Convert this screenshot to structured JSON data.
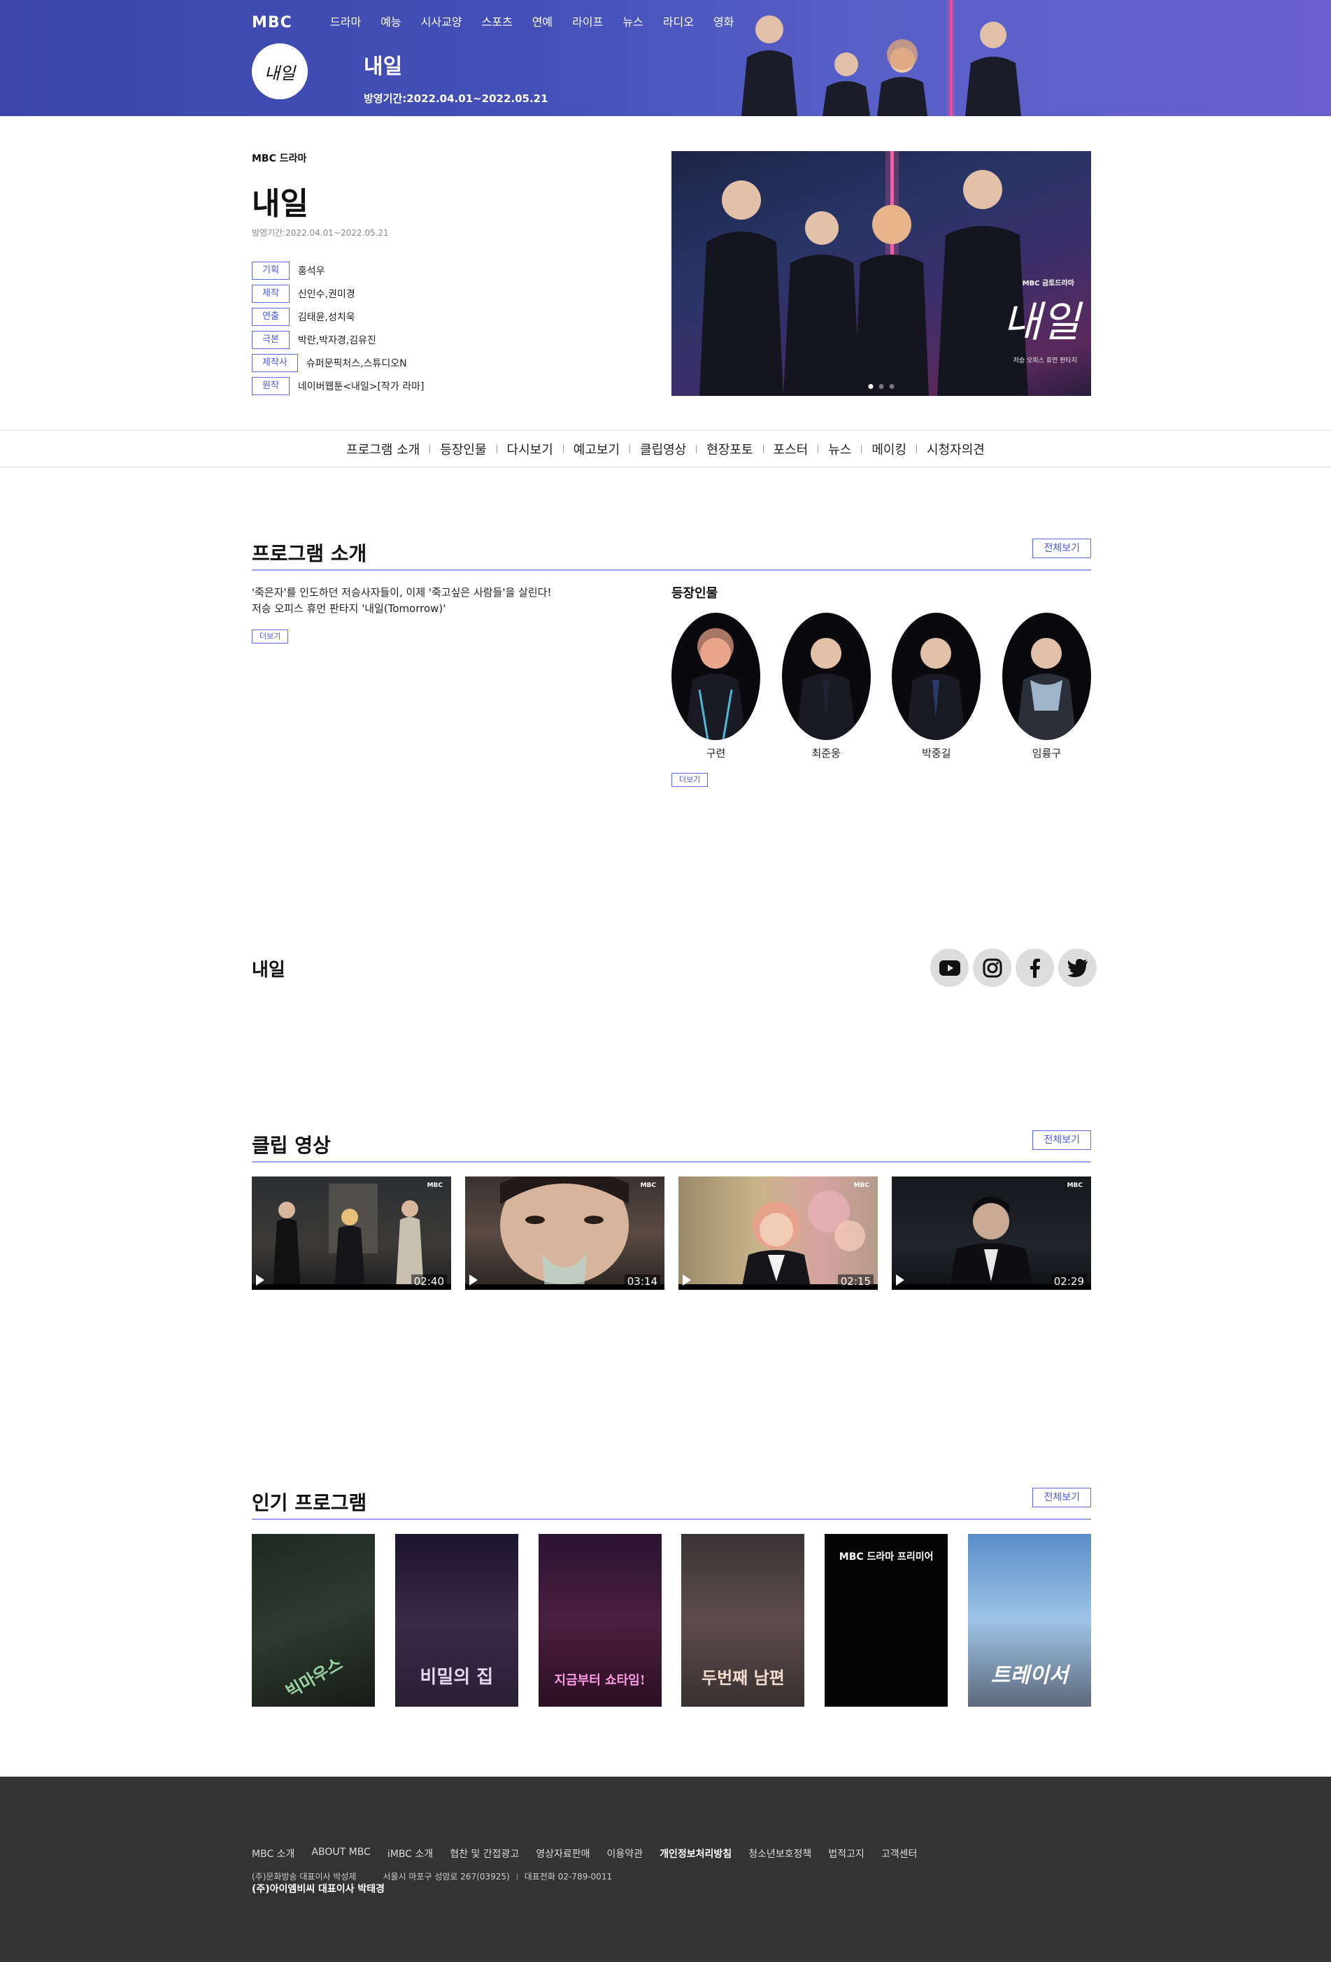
{
  "header": {
    "logo": "MBC",
    "gnb": [
      "드라마",
      "예능",
      "시사교양",
      "스포츠",
      "연예",
      "라이프",
      "뉴스",
      "라디오",
      "영화"
    ],
    "circle_logo": "내일",
    "title": "내일",
    "date": "방영기간:2022.04.01~2022.05.21"
  },
  "info": {
    "category": "MBC 드라마",
    "title": "내일",
    "date": "방영기간:2022.04.01~2022.05.21",
    "credits": [
      {
        "label": "기획",
        "value": "홍석우"
      },
      {
        "label": "제작",
        "value": "신인수,권미경"
      },
      {
        "label": "연출",
        "value": "김태윤,성치욱"
      },
      {
        "label": "극본",
        "value": "박란,박자경,김유진"
      },
      {
        "label": "제작사",
        "value": "슈퍼문픽처스,스튜디오N"
      },
      {
        "label": "원작",
        "value": "네이버웹툰<내일>[작가 라마]"
      }
    ],
    "poster_logo": "MBC 금토드라마",
    "poster_title": "내일",
    "poster_tagline": "저승 오피스 휴먼 판타지"
  },
  "subnav": [
    "프로그램 소개",
    "등장인물",
    "다시보기",
    "예고보기",
    "클립영상",
    "현장포토",
    "포스터",
    "뉴스",
    "메이킹",
    "시청자의견"
  ],
  "program_intro": {
    "heading": "프로그램 소개",
    "view_all": "전체보기",
    "lines": [
      "'죽은자'를 인도하던 저승사자들이, 이제 '죽고싶은 사람들'을 살린다!",
      "저승 오피스 휴먼 판타지 '내일(Tomorrow)'"
    ],
    "more": "더보기",
    "characters_heading": "등장인물",
    "characters": [
      "구련",
      "최준웅",
      "박중길",
      "임륭구"
    ],
    "characters_more": "더보기"
  },
  "social": {
    "title": "내일",
    "icons": [
      "youtube-icon",
      "instagram-icon",
      "facebook-icon",
      "twitter-icon"
    ]
  },
  "clips": {
    "heading": "클립 영상",
    "view_all": "전체보기",
    "items": [
      {
        "duration": "02:40",
        "badge": "MBC"
      },
      {
        "duration": "03:14",
        "badge": "MBC"
      },
      {
        "duration": "02:15",
        "badge": "MBC"
      },
      {
        "duration": "02:29",
        "badge": "MBC"
      }
    ]
  },
  "popular": {
    "heading": "인기 프로그램",
    "view_all": "전체보기",
    "items": [
      "빅마우스",
      "비밀의 집",
      "지금부터 쇼타임!",
      "두번째 남편",
      "MBC 드라마 프리미어",
      "트레이서"
    ]
  },
  "footer": {
    "links": [
      "MBC 소개",
      "ABOUT MBC",
      "iMBC 소개",
      "협찬 및 간접광고",
      "영상자료판매",
      "이용약관",
      "개인정보처리방침",
      "청소년보호정책",
      "법적고지",
      "고객센터"
    ],
    "company": "(주)문화방송 대표이사 박성제",
    "address": "서울시 마포구 성암로 267(03925)",
    "phone": "대표전화 02-789-0011",
    "corp": "(주)아이엠비씨 대표이사 박태경"
  }
}
